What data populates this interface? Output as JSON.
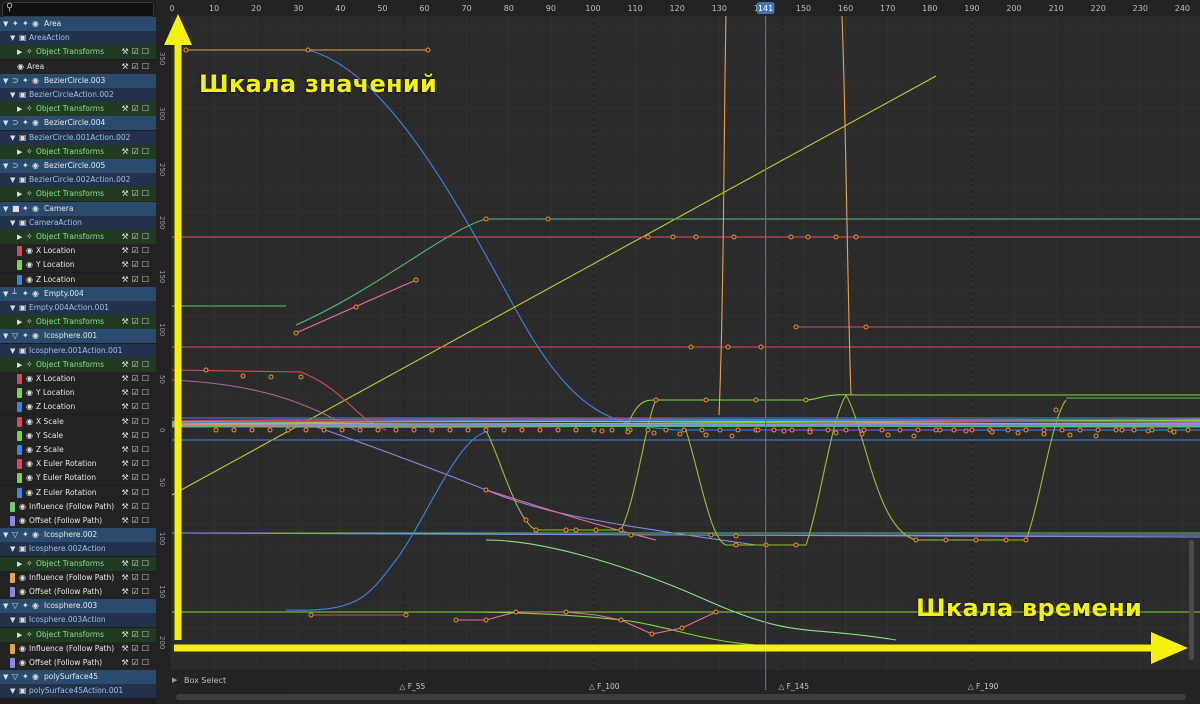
{
  "colors": {
    "x_channel": "#e0455a",
    "y_channel": "#7ed63a",
    "z_channel": "#3c84e6",
    "orange_channel": "#e8a050",
    "purple_channel": "#8a88e6",
    "annotation": "#f5f10f",
    "playhead": "#4772b3"
  },
  "outliner": {
    "search_icon": "magnifier-icon",
    "rows": [
      {
        "kind": "obj",
        "indent": 0,
        "label": "Area",
        "icon": "light-icon"
      },
      {
        "kind": "act",
        "indent": 1,
        "label": "AreaAction",
        "icon": "action-icon"
      },
      {
        "kind": "tr",
        "indent": 2,
        "label": "Object Transforms",
        "icon": "transform-icon"
      },
      {
        "kind": "ch",
        "indent": 2,
        "label": "Area",
        "icon": "light-icon",
        "swatch": ""
      },
      {
        "kind": "obj",
        "indent": 0,
        "label": "BezierCircle.003",
        "icon": "curve-icon"
      },
      {
        "kind": "act",
        "indent": 1,
        "label": "BezierCircleAction.002",
        "icon": "action-icon"
      },
      {
        "kind": "tr",
        "indent": 2,
        "label": "Object Transforms",
        "icon": "transform-icon"
      },
      {
        "kind": "obj",
        "indent": 0,
        "label": "BezierCircle.004",
        "icon": "curve-icon"
      },
      {
        "kind": "act",
        "indent": 1,
        "label": "BezierCircle.001Action.002",
        "icon": "action-icon"
      },
      {
        "kind": "tr",
        "indent": 2,
        "label": "Object Transforms",
        "icon": "transform-icon"
      },
      {
        "kind": "obj",
        "indent": 0,
        "label": "BezierCircle.005",
        "icon": "curve-icon"
      },
      {
        "kind": "act",
        "indent": 1,
        "label": "BezierCircle.002Action.002",
        "icon": "action-icon"
      },
      {
        "kind": "tr",
        "indent": 2,
        "label": "Object Transforms",
        "icon": "transform-icon"
      },
      {
        "kind": "obj",
        "indent": 0,
        "label": "Camera",
        "icon": "camera-icon"
      },
      {
        "kind": "act",
        "indent": 1,
        "label": "CameraAction",
        "icon": "action-icon"
      },
      {
        "kind": "tr",
        "indent": 2,
        "label": "Object Transforms",
        "icon": "transform-icon"
      },
      {
        "kind": "ch",
        "indent": 2,
        "label": "X Location",
        "swatch": "#e0455a"
      },
      {
        "kind": "ch",
        "indent": 2,
        "label": "Y Location",
        "swatch": "#7ed63a"
      },
      {
        "kind": "ch",
        "indent": 2,
        "label": "Z Location",
        "swatch": "#3c84e6"
      },
      {
        "kind": "obj",
        "indent": 0,
        "label": "Empty.004",
        "icon": "empty-icon"
      },
      {
        "kind": "act",
        "indent": 1,
        "label": "Empty.004Action.001",
        "icon": "action-icon"
      },
      {
        "kind": "tr",
        "indent": 2,
        "label": "Object Transforms",
        "icon": "transform-icon"
      },
      {
        "kind": "obj",
        "indent": 0,
        "label": "Icosphere.001",
        "icon": "mesh-icon"
      },
      {
        "kind": "act",
        "indent": 1,
        "label": "Icosphere.001Action.001",
        "icon": "action-icon"
      },
      {
        "kind": "tr",
        "indent": 2,
        "label": "Object Transforms",
        "icon": "transform-icon"
      },
      {
        "kind": "ch",
        "indent": 2,
        "label": "X Location",
        "swatch": "#e0455a"
      },
      {
        "kind": "ch",
        "indent": 2,
        "label": "Y Location",
        "swatch": "#7ed63a"
      },
      {
        "kind": "ch",
        "indent": 2,
        "label": "Z Location",
        "swatch": "#3c84e6"
      },
      {
        "kind": "ch",
        "indent": 2,
        "label": "X Scale",
        "swatch": "#e0455a"
      },
      {
        "kind": "ch",
        "indent": 2,
        "label": "Y Scale",
        "swatch": "#7ed63a"
      },
      {
        "kind": "ch",
        "indent": 2,
        "label": "Z Scale",
        "swatch": "#3c84e6"
      },
      {
        "kind": "ch",
        "indent": 2,
        "label": "X Euler Rotation",
        "swatch": "#e0455a"
      },
      {
        "kind": "ch",
        "indent": 2,
        "label": "Y Euler Rotation",
        "swatch": "#7ed63a"
      },
      {
        "kind": "ch",
        "indent": 2,
        "label": "Z Euler Rotation",
        "swatch": "#3c84e6"
      },
      {
        "kind": "ch",
        "indent": 1,
        "label": "Influence (Follow Path)",
        "swatch": "#6fd06f"
      },
      {
        "kind": "ch",
        "indent": 1,
        "label": "Offset (Follow Path)",
        "swatch": "#8a88e6"
      },
      {
        "kind": "obj",
        "indent": 0,
        "label": "Icosphere.002",
        "icon": "mesh-icon"
      },
      {
        "kind": "act",
        "indent": 1,
        "label": "Icosphere.002Action",
        "icon": "action-icon"
      },
      {
        "kind": "tr",
        "indent": 2,
        "label": "Object Transforms",
        "icon": "transform-icon"
      },
      {
        "kind": "ch",
        "indent": 1,
        "label": "Influence (Follow Path)",
        "swatch": "#e8a050"
      },
      {
        "kind": "ch",
        "indent": 1,
        "label": "Offset (Follow Path)",
        "swatch": "#8a88e6"
      },
      {
        "kind": "obj",
        "indent": 0,
        "label": "Icosphere.003",
        "icon": "mesh-icon"
      },
      {
        "kind": "act",
        "indent": 1,
        "label": "Icosphere.003Action",
        "icon": "action-icon"
      },
      {
        "kind": "tr",
        "indent": 2,
        "label": "Object Transforms",
        "icon": "transform-icon"
      },
      {
        "kind": "ch",
        "indent": 1,
        "label": "Influence (Follow Path)",
        "swatch": "#e8a050"
      },
      {
        "kind": "ch",
        "indent": 1,
        "label": "Offset (Follow Path)",
        "swatch": "#8a88e6"
      },
      {
        "kind": "obj",
        "indent": 0,
        "label": "polySurface45",
        "icon": "mesh-icon"
      },
      {
        "kind": "act",
        "indent": 1,
        "label": "polySurface45Action.001",
        "icon": "action-icon"
      }
    ]
  },
  "timeline": {
    "frame_ticks": [
      0,
      10,
      20,
      30,
      40,
      50,
      60,
      70,
      80,
      90,
      100,
      110,
      120,
      130,
      140,
      150,
      160,
      170,
      180,
      190,
      200,
      210,
      220,
      230,
      240
    ],
    "current_frame": "141",
    "value_ticks_top": [
      "350",
      "300",
      "250",
      "200",
      "150",
      "100",
      "50",
      "0"
    ],
    "value_ticks_bottom": [
      "50",
      "100",
      "150",
      "200"
    ],
    "markers": [
      "F_55",
      "F_100",
      "F_145",
      "F_190"
    ],
    "box_select_label": "Box Select"
  },
  "annotations": {
    "value_scale": "Шкала значений",
    "time_scale": "Шкала времени"
  }
}
